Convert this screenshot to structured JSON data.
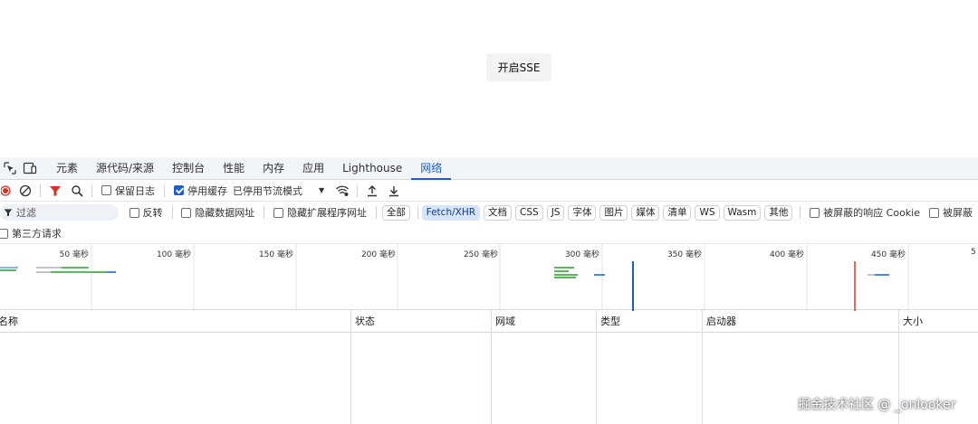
{
  "page": {
    "button_label": "开启SSE"
  },
  "devtools": {
    "tabs": [
      {
        "label": "元素",
        "active": false
      },
      {
        "label": "源代码/来源",
        "active": false
      },
      {
        "label": "控制台",
        "active": false
      },
      {
        "label": "性能",
        "active": false
      },
      {
        "label": "内存",
        "active": false
      },
      {
        "label": "应用",
        "active": false
      },
      {
        "label": "Lighthouse",
        "active": false
      },
      {
        "label": "网络",
        "active": true
      }
    ],
    "toolbar": {
      "preserve_log": {
        "label": "保留日志",
        "checked": false
      },
      "disable_cache": {
        "label": "停用缓存",
        "checked": true
      },
      "throttling": "已停用节流模式"
    },
    "filter": {
      "placeholder": "过滤",
      "invert": "反转",
      "hide_data_urls": "隐藏数据网址",
      "hide_extension_urls": "隐藏扩展程序网址",
      "types": [
        {
          "label": "全部",
          "active": false
        },
        {
          "label": "Fetch/XHR",
          "active": true
        },
        {
          "label": "文档",
          "active": false
        },
        {
          "label": "CSS",
          "active": false
        },
        {
          "label": "JS",
          "active": false
        },
        {
          "label": "字体",
          "active": false
        },
        {
          "label": "图片",
          "active": false
        },
        {
          "label": "媒体",
          "active": false
        },
        {
          "label": "清单",
          "active": false
        },
        {
          "label": "WS",
          "active": false
        },
        {
          "label": "Wasm",
          "active": false
        },
        {
          "label": "其他",
          "active": false
        }
      ],
      "blocked_response_cookies": "被屏蔽的响应 Cookie",
      "blocked_requests": "被屏蔽",
      "third_party": "第三方请求"
    },
    "overview_ticks": [
      "50 毫秒",
      "100 毫秒",
      "150 毫秒",
      "200 毫秒",
      "250 毫秒",
      "300 毫秒",
      "350 毫秒",
      "400 毫秒",
      "450 毫秒",
      "5"
    ],
    "columns": [
      "名称",
      "状态",
      "网域",
      "类型",
      "启动器",
      "大小"
    ],
    "colors": {
      "accent": "#1a5fd0",
      "record": "#d93025",
      "filter_icon": "#d93025",
      "dom_content_loaded": "#1a5fd0",
      "load": "#e06c5a"
    }
  },
  "watermark": "掘金技术社区 @ _onlooker"
}
